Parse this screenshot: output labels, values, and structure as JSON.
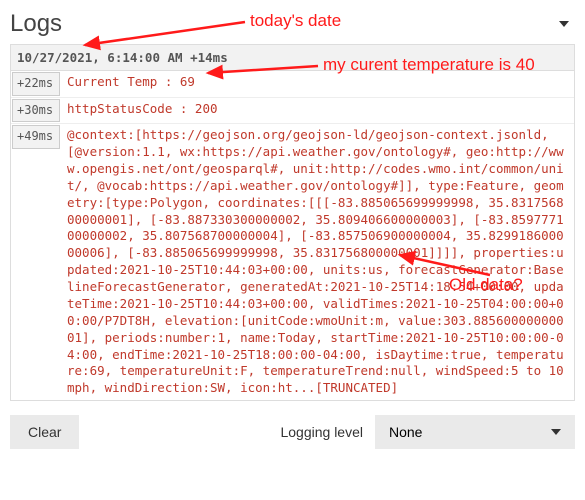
{
  "header": {
    "title": "Logs"
  },
  "timestamp": "10/27/2021, 6:14:00 AM +14ms",
  "rows": [
    {
      "offset": "+22ms",
      "msg": "Current Temp : 69"
    },
    {
      "offset": "+30ms",
      "msg": "httpStatusCode : 200"
    },
    {
      "offset": "+49ms",
      "msg": "@context:[https://geojson.org/geojson-ld/geojson-context.jsonld, [@version:1.1, wx:https://api.weather.gov/ontology#, geo:http://www.opengis.net/ont/geosparql#, unit:http://codes.wmo.int/common/unit/, @vocab:https://api.weather.gov/ontology#]], type:Feature, geometry:[type:Polygon, coordinates:[[[-83.885065699999998, 35.831756800000001], [-83.887330300000002, 35.809406600000003], [-83.859777100000002, 35.807568700000004], [-83.857506900000004, 35.829918600000006], [-83.885065699999998, 35.831756800000001]]]], properties:updated:2021-10-25T10:44:03+00:00, units:us, forecastGenerator:BaselineForecastGenerator, generatedAt:2021-10-25T14:18:54+00:00, updateTime:2021-10-25T10:44:03+00:00, validTimes:2021-10-25T04:00:00+00:00/P7DT8H, elevation:[unitCode:wmoUnit:m, value:303.88560000000001], periods:number:1, name:Today, startTime:2021-10-25T10:00:00-04:00, endTime:2021-10-25T18:00:00-04:00, isDaytime:true, temperature:69, temperatureUnit:F, temperatureTrend:null, windSpeed:5 to 10 mph, windDirection:SW, icon:ht...[TRUNCATED]"
    }
  ],
  "footer": {
    "clear_label": "Clear",
    "level_label": "Logging level",
    "level_value": "None"
  },
  "annotations": {
    "a1": "today's date",
    "a2": "my curent temperature is 40",
    "a3": "Old data?"
  },
  "colors": {
    "annotation_red": "#ff1a1a",
    "log_red": "#c0392b"
  }
}
